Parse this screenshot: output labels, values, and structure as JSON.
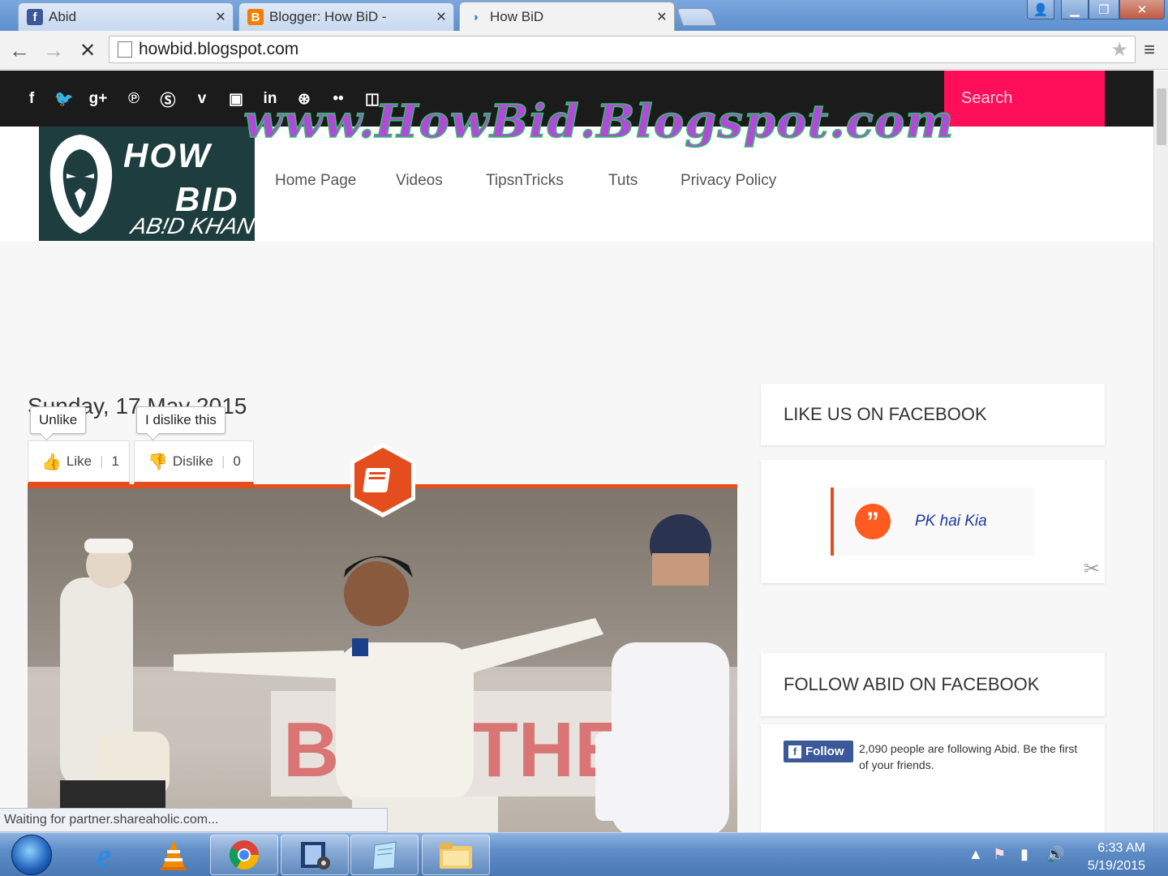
{
  "browser": {
    "tabs": [
      {
        "label": "Abid",
        "icon": "facebook-icon"
      },
      {
        "label": "Blogger: How BiD -",
        "icon": "blogger-icon"
      },
      {
        "label": "How BiD",
        "icon": "loading-icon"
      }
    ],
    "url": "howbid.blogspot.com",
    "status_text": "Waiting for partner.shareaholic.com..."
  },
  "site": {
    "search_placeholder": "Search",
    "watermark": "www.HowBid.Blogspot.com",
    "logo": {
      "line1": "HOW",
      "line2": "BID",
      "line3": "AB!D KHAN"
    },
    "social_icons": [
      "facebook-icon",
      "twitter-icon",
      "google-plus-icon",
      "pinterest-icon",
      "skype-icon",
      "vimeo-icon",
      "youtube-icon",
      "linkedin-icon",
      "dribbble-icon",
      "flickr-icon",
      "instagram-icon"
    ],
    "nav": [
      "Home Page",
      "Videos",
      "TipsnTricks",
      "Tuts",
      "Privacy Policy"
    ]
  },
  "post": {
    "date": "Sunday, 17 May 2015",
    "tooltip_unlike": "Unlike",
    "tooltip_dislike": "I dislike this",
    "like_label": "Like",
    "like_count": "1",
    "dislike_label": "Dislike",
    "dislike_count": "0",
    "hero_banner_text": "BRA THE"
  },
  "sidebar": {
    "like_title": "LIKE US ON FACEBOOK",
    "quote_text": "PK hai Kia",
    "follow_title": "FOLLOW ABID ON FACEBOOK",
    "follow_button": "Follow",
    "follow_text": "2,090 people are following Abid. Be the first of your friends."
  },
  "taskbar": {
    "time": "6:33 AM",
    "date": "5/19/2015"
  },
  "colors": {
    "accent": "#e44d1e",
    "search_bg": "#ff0f5a",
    "topbar": "#1b1b1b",
    "facebook": "#3b5998"
  }
}
